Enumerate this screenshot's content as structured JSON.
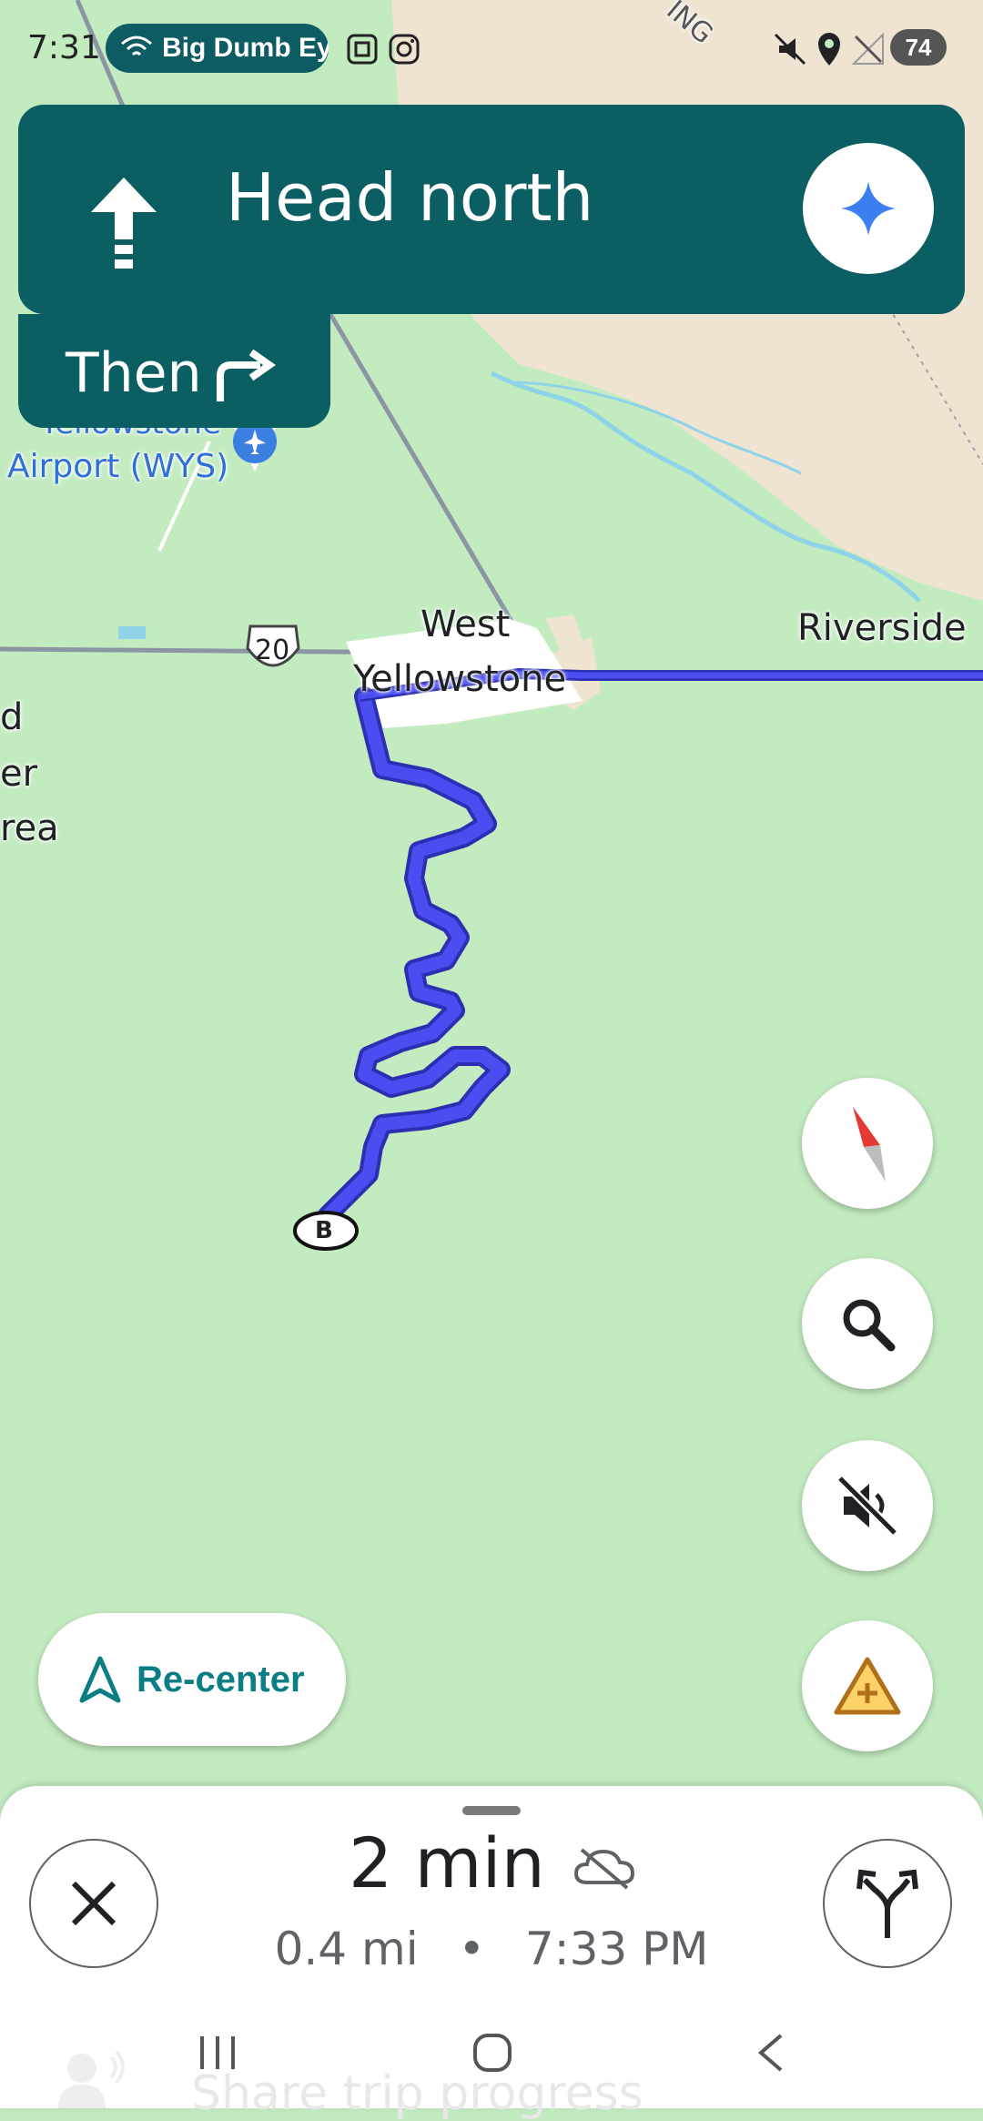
{
  "status_bar": {
    "time": "7:31",
    "notification_pill": "Big Dumb Ey",
    "battery": "74"
  },
  "map": {
    "labels": {
      "top_road_fragment": "ING",
      "airport_line1": "Yellowstone",
      "airport_line2": "Airport (WYS)",
      "highway_shield": "20",
      "town_line1": "West",
      "town_line2": "Yellowstone",
      "riverside": "Riverside",
      "left_line1": "d",
      "left_line2": "er",
      "left_line3": "rea",
      "destination_marker": "B"
    },
    "route_color": "#4a4ef0"
  },
  "navigation": {
    "instruction": "Head north",
    "then_label": "Then"
  },
  "controls": {
    "recenter_label": "Re-center"
  },
  "trip": {
    "duration": "2 min",
    "distance": "0.4 mi",
    "separator": "•",
    "arrival_time": "7:33 PM"
  },
  "background_text": "Share trip progress",
  "colors": {
    "nav_card": "#0b5e61",
    "map_land": "#c3ebc0",
    "map_desert": "#efe4d2",
    "accent_teal": "#0b7d84"
  }
}
